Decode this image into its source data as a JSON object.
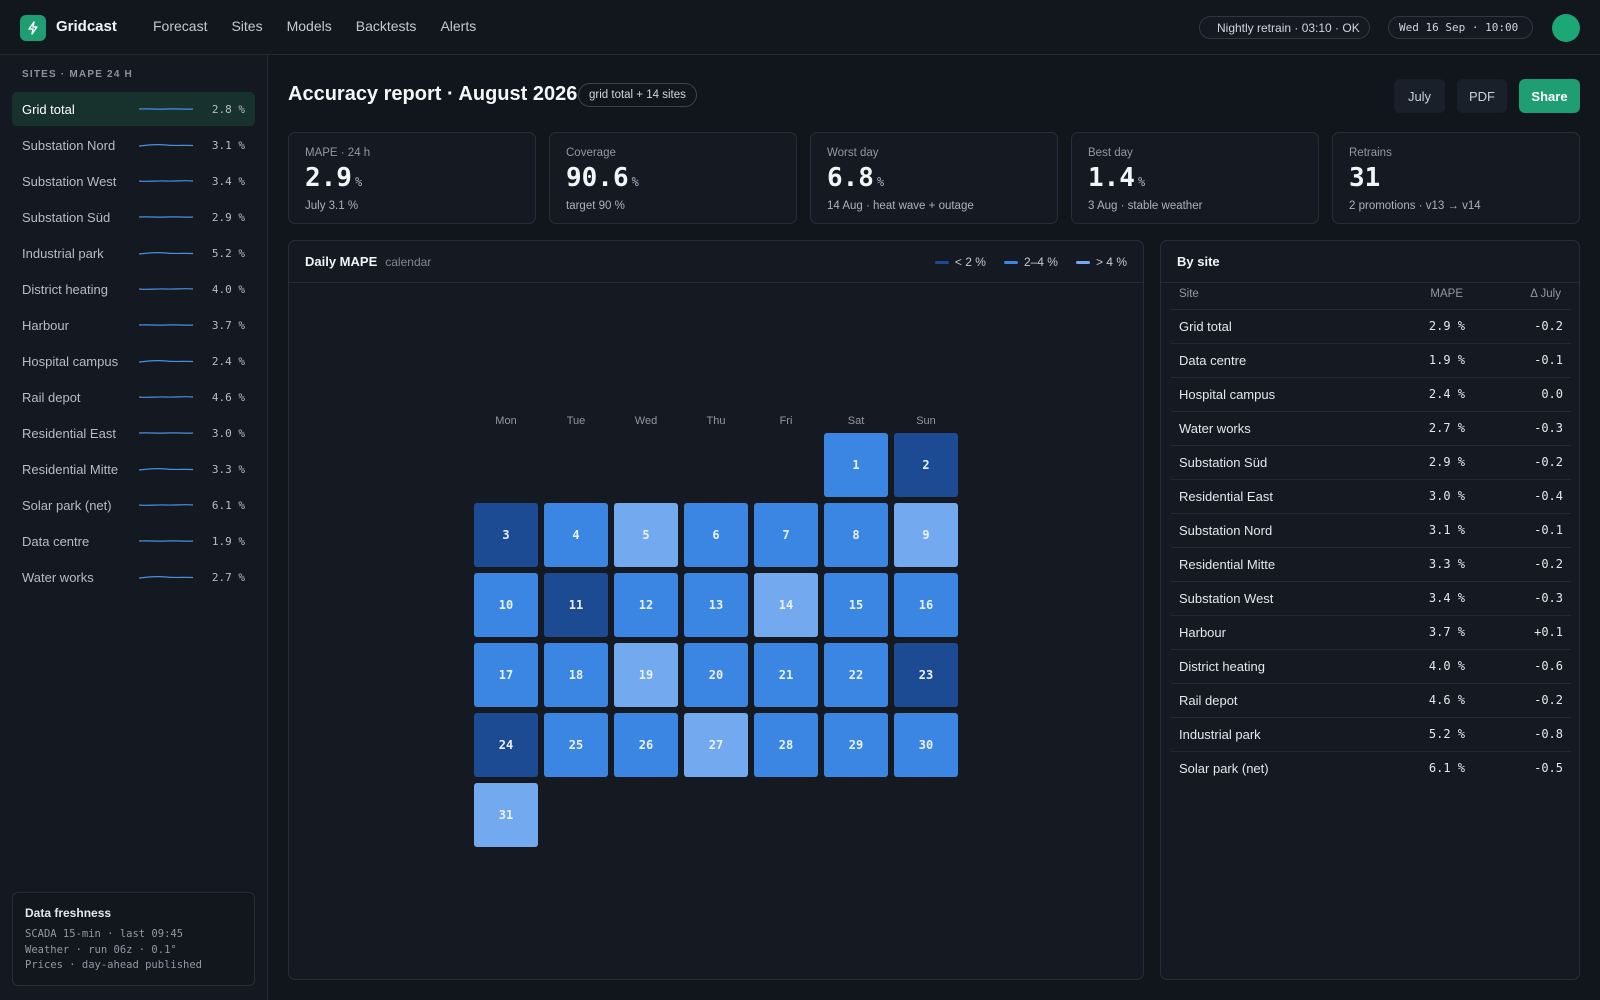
{
  "app": {
    "title": "Gridcast"
  },
  "nav": [
    "Forecast",
    "Sites",
    "Models",
    "Backtests",
    "Alerts"
  ],
  "status": {
    "retrain": "Nightly retrain · 03:10 · OK",
    "datetime": "Wed 16 Sep · 10:00"
  },
  "sidebar": {
    "heading": "SITES · MAPE 24 H",
    "items": [
      {
        "label": "Grid total",
        "value": "2.8 %",
        "active": true
      },
      {
        "label": "Substation Nord",
        "value": "3.1 %"
      },
      {
        "label": "Substation West",
        "value": "3.4 %"
      },
      {
        "label": "Substation Süd",
        "value": "2.9 %"
      },
      {
        "label": "Industrial park",
        "value": "5.2 %"
      },
      {
        "label": "District heating",
        "value": "4.0 %"
      },
      {
        "label": "Harbour",
        "value": "3.7 %"
      },
      {
        "label": "Hospital campus",
        "value": "2.4 %"
      },
      {
        "label": "Rail depot",
        "value": "4.6 %"
      },
      {
        "label": "Residential East",
        "value": "3.0 %"
      },
      {
        "label": "Residential Mitte",
        "value": "3.3 %"
      },
      {
        "label": "Solar park (net)",
        "value": "6.1 %"
      },
      {
        "label": "Data centre",
        "value": "1.9 %"
      },
      {
        "label": "Water works",
        "value": "2.7 %"
      }
    ],
    "freshness": {
      "title": "Data freshness",
      "lines": [
        "SCADA 15-min · last 09:45",
        "Weather · run 06z · 0.1°",
        "Prices · day-ahead published"
      ]
    }
  },
  "page": {
    "title": "Accuracy report · August 2026",
    "scope": "grid total + 14 sites",
    "buttons": {
      "july": "July",
      "pdf": "PDF",
      "share": "Share"
    }
  },
  "kpis": [
    {
      "label": "MAPE · 24 h",
      "value": "2.9",
      "unit": "%",
      "sub": "July 3.1 %"
    },
    {
      "label": "Coverage",
      "value": "90.6",
      "unit": "%",
      "sub": "target 90 %"
    },
    {
      "label": "Worst day",
      "value": "6.8",
      "unit": "%",
      "sub": "14 Aug · heat wave + outage"
    },
    {
      "label": "Best day",
      "value": "1.4",
      "unit": "%",
      "sub": "3 Aug · stable weather"
    },
    {
      "label": "Retrains",
      "value": "31",
      "unit": "",
      "sub": "2 promotions · v13 → v14"
    }
  ],
  "calendar": {
    "title": "Daily MAPE",
    "subtitle": "calendar",
    "legend": [
      {
        "label": "< 2 %",
        "color": "#1c4b94"
      },
      {
        "label": "2–4 %",
        "color": "#3a86e2"
      },
      {
        "label": "> 4 %",
        "color": "#73a9ef"
      }
    ],
    "weekdays": [
      "Mon",
      "Tue",
      "Wed",
      "Thu",
      "Fri",
      "Sat",
      "Sun"
    ],
    "first_weekday_index": 5,
    "days": [
      {
        "d": 1,
        "level": "mid"
      },
      {
        "d": 2,
        "level": "low"
      },
      {
        "d": 3,
        "level": "low"
      },
      {
        "d": 4,
        "level": "mid"
      },
      {
        "d": 5,
        "level": "high"
      },
      {
        "d": 6,
        "level": "mid"
      },
      {
        "d": 7,
        "level": "mid"
      },
      {
        "d": 8,
        "level": "mid"
      },
      {
        "d": 9,
        "level": "high"
      },
      {
        "d": 10,
        "level": "mid"
      },
      {
        "d": 11,
        "level": "low"
      },
      {
        "d": 12,
        "level": "mid"
      },
      {
        "d": 13,
        "level": "mid"
      },
      {
        "d": 14,
        "level": "high"
      },
      {
        "d": 15,
        "level": "mid"
      },
      {
        "d": 16,
        "level": "mid"
      },
      {
        "d": 17,
        "level": "mid"
      },
      {
        "d": 18,
        "level": "mid"
      },
      {
        "d": 19,
        "level": "high"
      },
      {
        "d": 20,
        "level": "mid"
      },
      {
        "d": 21,
        "level": "mid"
      },
      {
        "d": 22,
        "level": "mid"
      },
      {
        "d": 23,
        "level": "low"
      },
      {
        "d": 24,
        "level": "low"
      },
      {
        "d": 25,
        "level": "mid"
      },
      {
        "d": 26,
        "level": "mid"
      },
      {
        "d": 27,
        "level": "high"
      },
      {
        "d": 28,
        "level": "mid"
      },
      {
        "d": 29,
        "level": "mid"
      },
      {
        "d": 30,
        "level": "mid"
      },
      {
        "d": 31,
        "level": "high"
      }
    ]
  },
  "by_site": {
    "title": "By site",
    "headers": {
      "site": "Site",
      "mape": "MAPE",
      "delta": "Δ July"
    },
    "rows": [
      {
        "site": "Grid total",
        "mape": "2.9 %",
        "delta": "-0.2"
      },
      {
        "site": "Data centre",
        "mape": "1.9 %",
        "delta": "-0.1"
      },
      {
        "site": "Hospital campus",
        "mape": "2.4 %",
        "delta": "0.0"
      },
      {
        "site": "Water works",
        "mape": "2.7 %",
        "delta": "-0.3"
      },
      {
        "site": "Substation Süd",
        "mape": "2.9 %",
        "delta": "-0.2"
      },
      {
        "site": "Residential East",
        "mape": "3.0 %",
        "delta": "-0.4"
      },
      {
        "site": "Substation Nord",
        "mape": "3.1 %",
        "delta": "-0.1"
      },
      {
        "site": "Residential Mitte",
        "mape": "3.3 %",
        "delta": "-0.2"
      },
      {
        "site": "Substation West",
        "mape": "3.4 %",
        "delta": "-0.3"
      },
      {
        "site": "Harbour",
        "mape": "3.7 %",
        "delta": "+0.1"
      },
      {
        "site": "District heating",
        "mape": "4.0 %",
        "delta": "-0.6"
      },
      {
        "site": "Rail depot",
        "mape": "4.6 %",
        "delta": "-0.2"
      },
      {
        "site": "Industrial park",
        "mape": "5.2 %",
        "delta": "-0.8"
      },
      {
        "site": "Solar park (net)",
        "mape": "6.1 %",
        "delta": "-0.5"
      }
    ]
  }
}
